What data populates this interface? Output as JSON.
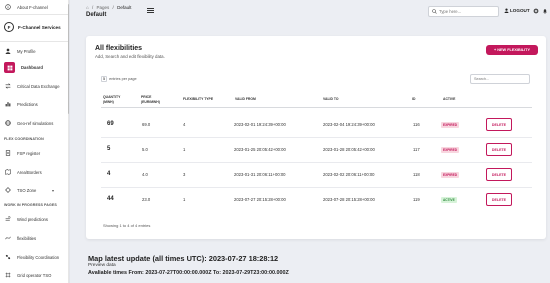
{
  "colors": {
    "accent": "#c3185c",
    "expired_bg": "#f8d6df",
    "expired_fg": "#c3185c",
    "active_bg": "#d7f3d9",
    "active_fg": "#2e8b3d"
  },
  "sidebar": {
    "about_label": "About F-channel",
    "brand": "F-Channel Services",
    "brand_logo": "F",
    "profile_label": "My Profile",
    "items_top": [
      {
        "label": "Dashboard",
        "icon": "dashboard-icon"
      },
      {
        "label": "Critical Data Exchange",
        "icon": "exchange-icon"
      },
      {
        "label": "Predictions",
        "icon": "chart-icon"
      },
      {
        "label": "Geo-ref simulations",
        "icon": "globe-icon"
      }
    ],
    "section1": "FLEX COORDINATION",
    "items_flex": [
      {
        "label": "FSP register",
        "icon": "register-icon"
      },
      {
        "label": "Area/Borders",
        "icon": "area-icon"
      },
      {
        "label": "TSO Zone",
        "icon": "zone-icon"
      }
    ],
    "section2": "WORK IN PROGRESS PAGES",
    "items_wip": [
      {
        "label": "Wind predictions",
        "icon": "wind-icon"
      },
      {
        "label": "flexibilities",
        "icon": "flex-icon"
      },
      {
        "label": "Flexibility Coordination",
        "icon": "coordination-icon"
      },
      {
        "label": "Grid operator TSO",
        "icon": "grid-icon"
      }
    ]
  },
  "header": {
    "breadcrumb": [
      "⌂",
      "/",
      "Pages",
      "/",
      "Default"
    ],
    "title": "Default",
    "search_placeholder": "Type here...",
    "logout_label": "LOGOUT"
  },
  "card": {
    "title": "All flexibilities",
    "subtitle": "Add, Search and edit flexibility data.",
    "new_button": "+ NEW FLEXIBILITY",
    "entries_value": "5",
    "entries_label": "entries per page",
    "search_placeholder": "Search...",
    "columns": {
      "quantity": [
        "QUANTITY",
        "(MWH)"
      ],
      "price": [
        "PRICE",
        "(EUR/MWH)"
      ],
      "type": "FLEXIBILITY TYPE",
      "from": "VALID FROM",
      "to": "VALID TO",
      "id": "ID",
      "active": "ACTIVE"
    },
    "rows": [
      {
        "quantity": "69",
        "price": "69.0",
        "type": "4",
        "from": "2023-02-01 19:24:39+00:00",
        "to": "2023-02-04 19:24:39+00:00",
        "id": "116",
        "status": "EXPIRED",
        "delete": "DELETE"
      },
      {
        "quantity": "5",
        "price": "5.0",
        "type": "1",
        "from": "2023-01-25 20:05:42+00:00",
        "to": "2023-01-28 20:05:42+00:00",
        "id": "117",
        "status": "EXPIRED",
        "delete": "DELETE"
      },
      {
        "quantity": "4",
        "price": "4.0",
        "type": "3",
        "from": "2023-01-31 20:06:11+00:00",
        "to": "2023-02-02 20:06:11+00:00",
        "id": "118",
        "status": "EXPIRED",
        "delete": "DELETE"
      },
      {
        "quantity": "44",
        "price": "23.0",
        "type": "1",
        "from": "2023-07-27 20:15:28+00:00",
        "to": "2023-07-28 20:15:28+00:00",
        "id": "119",
        "status": "ACTIVE",
        "delete": "DELETE"
      }
    ],
    "showing": "Showing 1 to 4 of 4 entries"
  },
  "footer": {
    "map_update": "Map latest update (all times UTC): 2023-07-27 18:28:12",
    "preview": "Preview data",
    "available": "Avaliable times From: 2023-07-27T00:00:00.000Z To: 2023-07-29T23:00:00.000Z"
  }
}
